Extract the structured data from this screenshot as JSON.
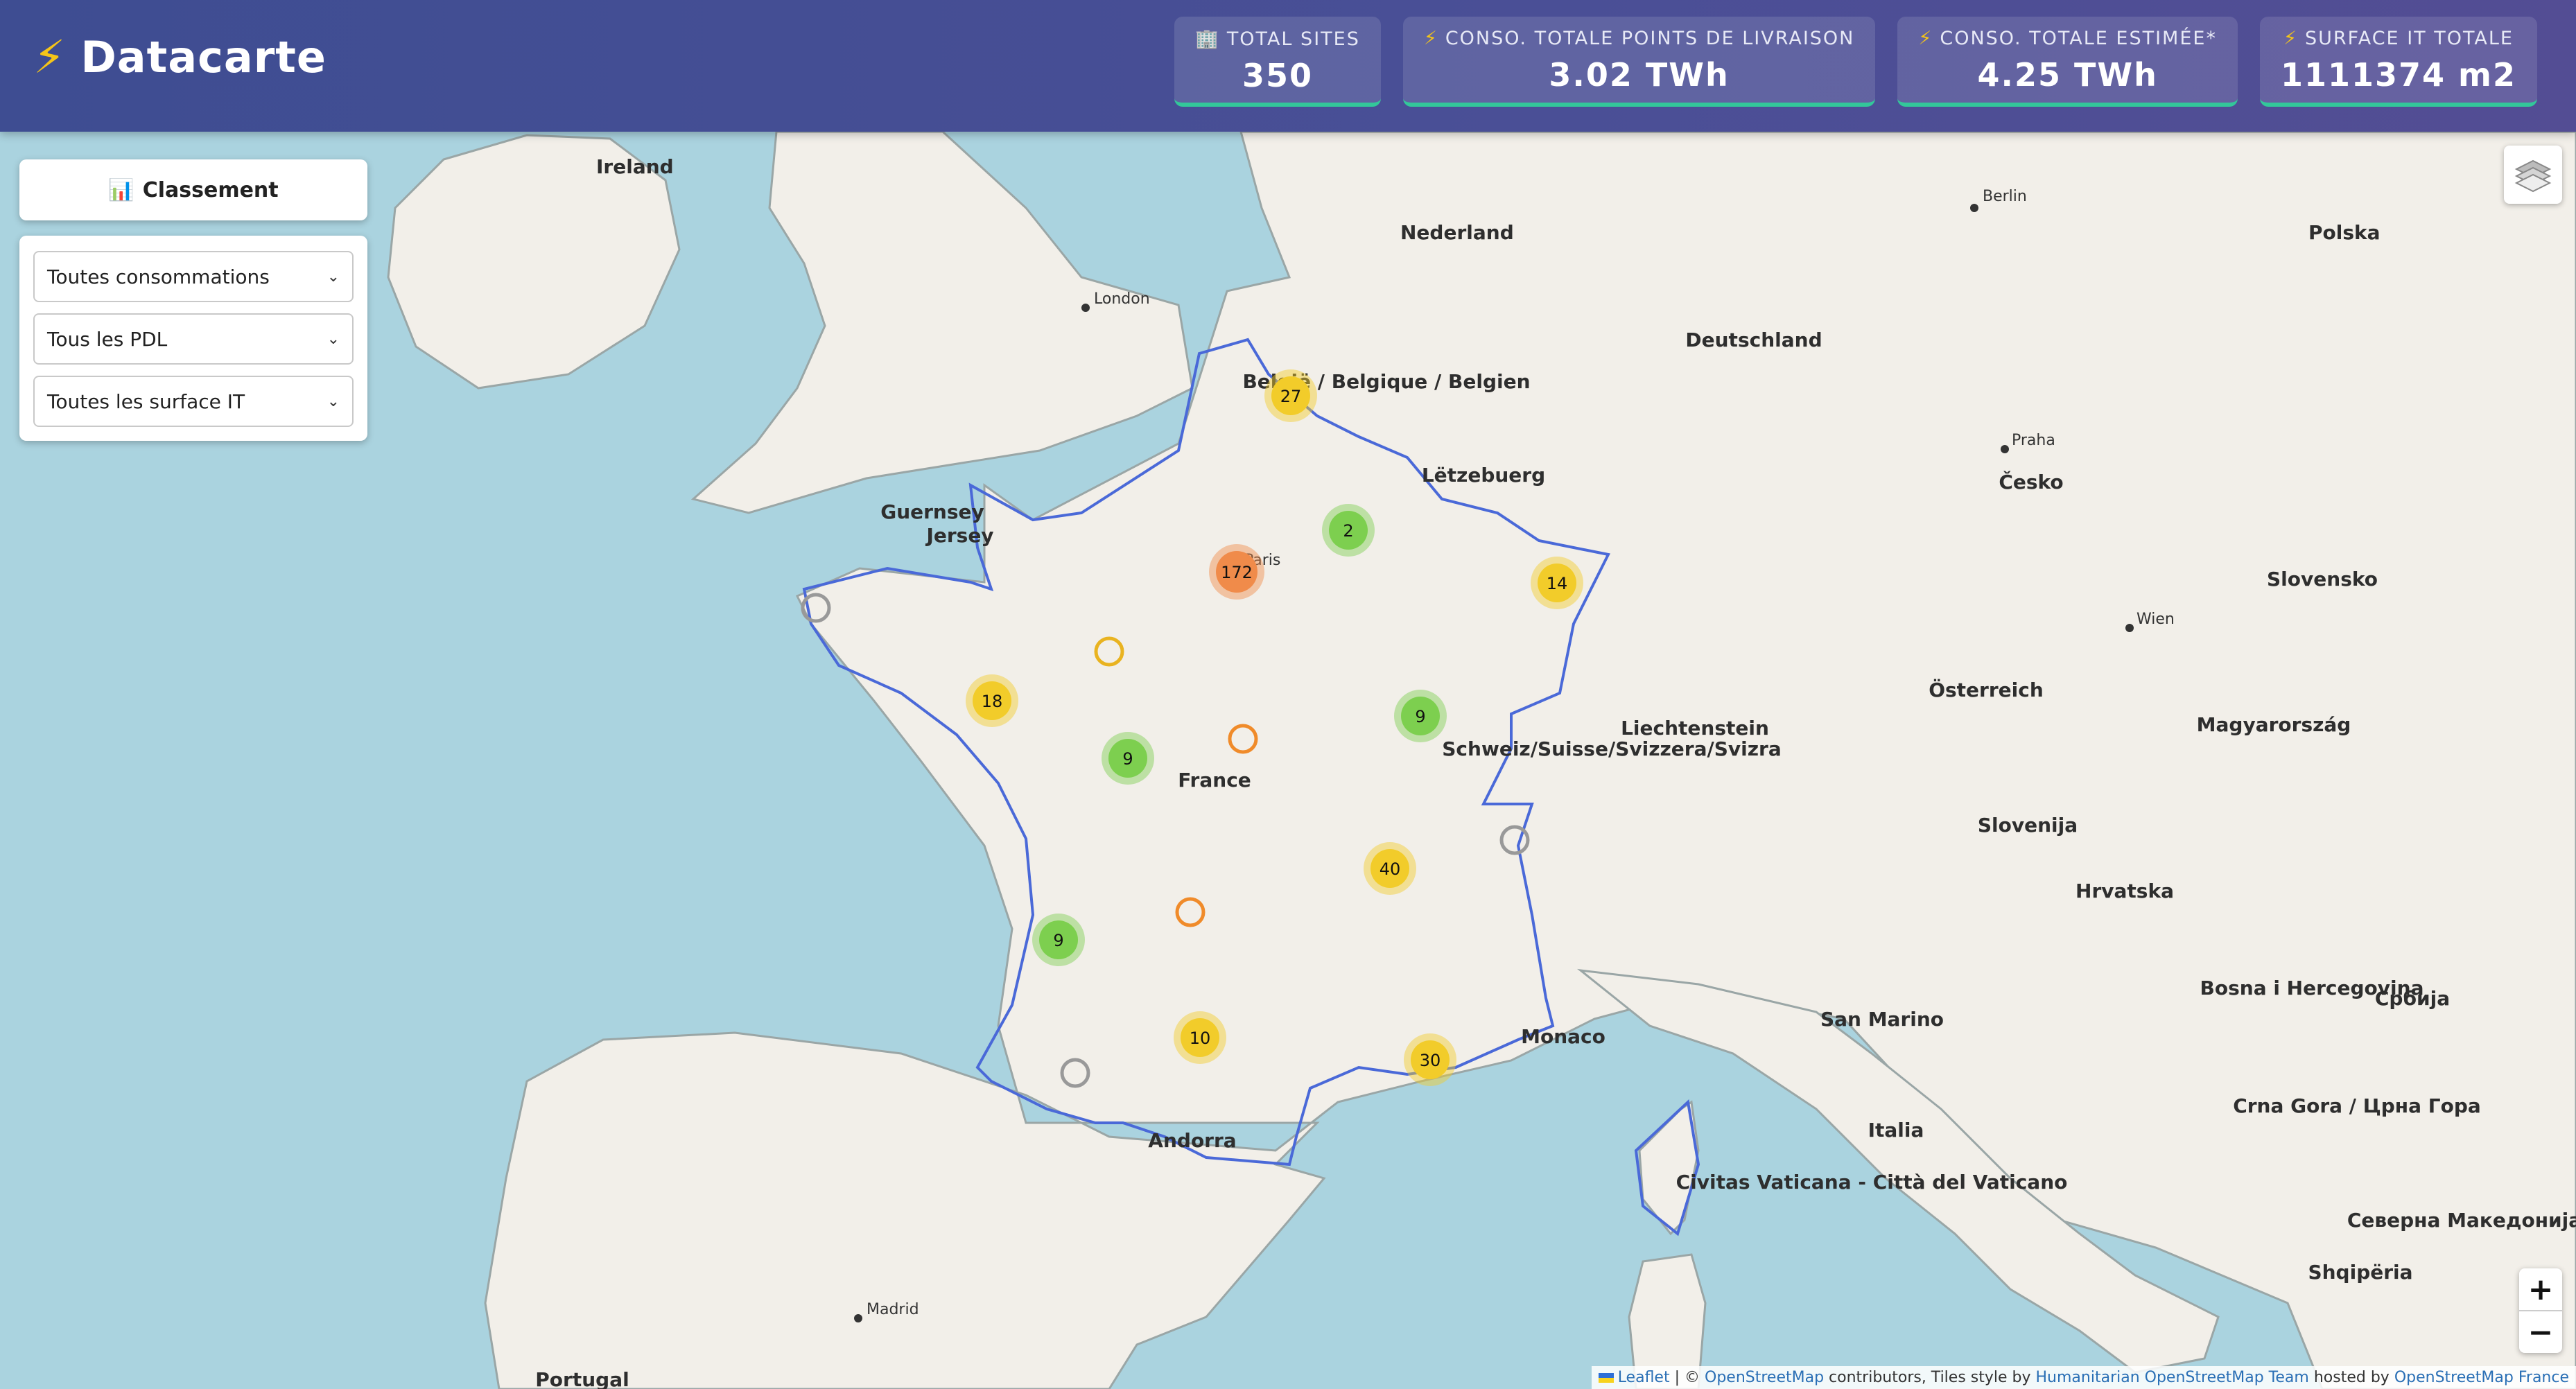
{
  "header": {
    "brand_icon": "bolt-icon",
    "title": "Datacarte",
    "stats": [
      {
        "icon": "building-icon",
        "label": "TOTAL SITES",
        "value": "350"
      },
      {
        "icon": "bolt-icon",
        "label": "CONSO. TOTALE POINTS DE LIVRAISON",
        "value": "3.02 TWh"
      },
      {
        "icon": "bolt-icon",
        "label": "CONSO. TOTALE ESTIMÉE*",
        "value": "4.25 TWh"
      },
      {
        "icon": "bolt-icon",
        "label": "SURFACE IT TOTALE",
        "value": "1111374 m2"
      }
    ]
  },
  "panel": {
    "ranking_button": "Classement",
    "ranking_icon": "bar-chart-icon",
    "filters": [
      {
        "selected": "Toutes consommations"
      },
      {
        "selected": "Tous les PDL"
      },
      {
        "selected": "Toutes les surface IT"
      }
    ]
  },
  "map": {
    "country_labels": [
      "Ireland",
      "Nederland",
      "België / Belgique / Belgien",
      "Lëtzebuerg",
      "Deutschland",
      "Polska",
      "Česko",
      "Slovensko",
      "Österreich",
      "Magyarország",
      "Liechtenstein",
      "Schweiz/Suisse/Svizzera/Svizra",
      "Slovenija",
      "Hrvatska",
      "Bosna i Hercegovina",
      "Србија",
      "Crna Gora / Црна Гора",
      "Северна Македонија",
      "Shqipëria",
      "San Marino",
      "Italia",
      "Civitas Vaticana - Città del Vaticano",
      "Monaco",
      "Andorra",
      "France",
      "Guernsey",
      "Jersey",
      "Portugal"
    ],
    "city_labels": [
      "London",
      "Paris",
      "Berlin",
      "Praha",
      "Wien",
      "Madrid"
    ],
    "clusters": [
      {
        "count": "27",
        "level": "medium"
      },
      {
        "count": "2",
        "level": "low"
      },
      {
        "count": "172",
        "level": "high"
      },
      {
        "count": "14",
        "level": "medium"
      },
      {
        "count": "18",
        "level": "medium"
      },
      {
        "count": "9",
        "level": "low"
      },
      {
        "count": "9",
        "level": "low"
      },
      {
        "count": "40",
        "level": "medium"
      },
      {
        "count": "9",
        "level": "low"
      },
      {
        "count": "10",
        "level": "medium"
      },
      {
        "count": "30",
        "level": "medium"
      }
    ],
    "colors": {
      "sea": "#aad3df",
      "land": "#f2efe9",
      "border": "#4a69d8",
      "low": "#7dcf4f",
      "medium": "#f2cc2a",
      "high": "#f08b4a"
    }
  },
  "controls": {
    "layers_icon": "layers-icon",
    "zoom_in": "+",
    "zoom_out": "−"
  },
  "attribution": {
    "leaflet": "Leaflet",
    "sep1": " | © ",
    "osm": "OpenStreetMap",
    "mid": " contributors, Tiles style by ",
    "hot": "Humanitarian OpenStreetMap Team",
    "hosted": " hosted by ",
    "osmfr": "OpenStreetMap France"
  }
}
